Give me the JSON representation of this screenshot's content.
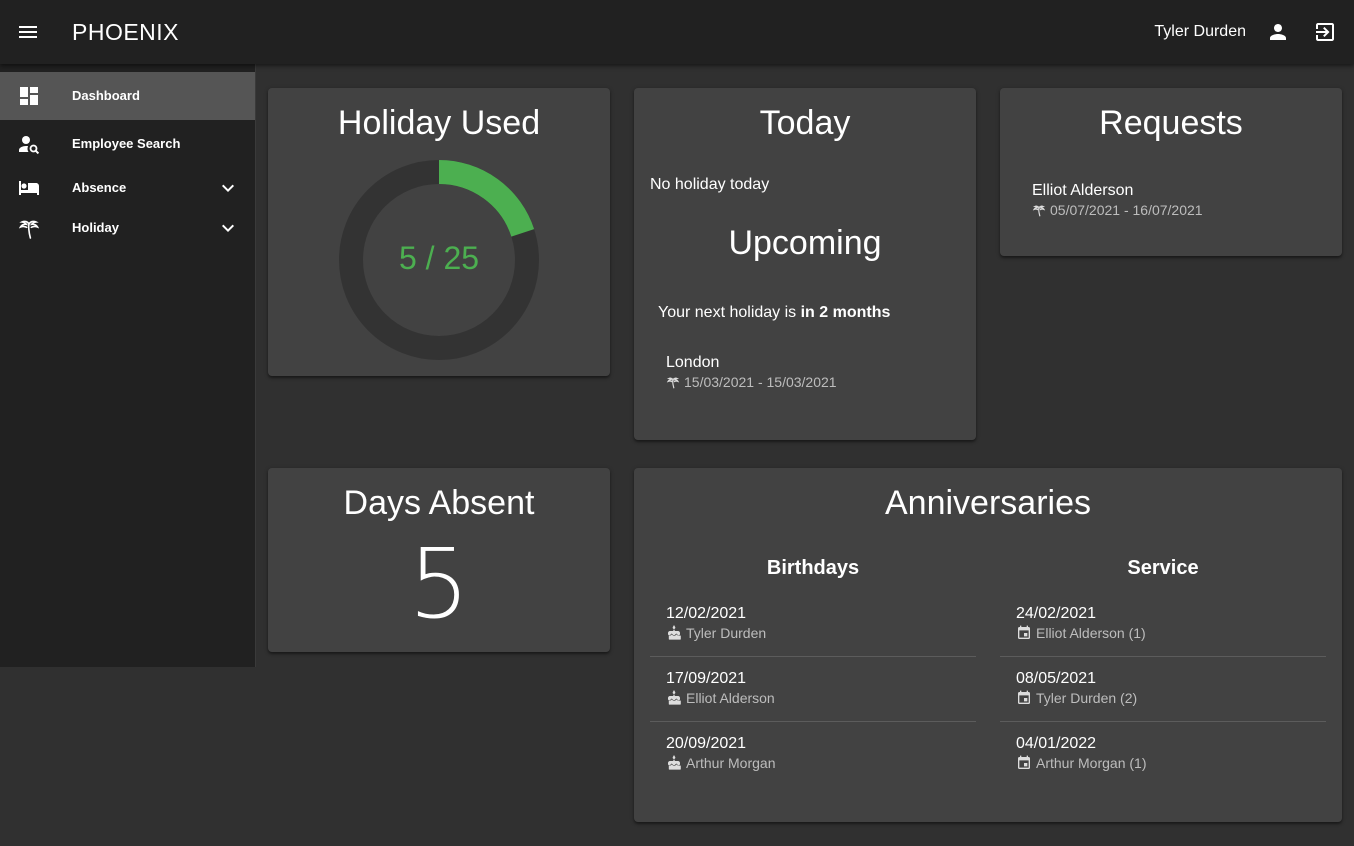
{
  "app": {
    "title": "PHOENIX"
  },
  "header": {
    "user_name": "Tyler Durden"
  },
  "nav": {
    "items": [
      {
        "label": "Dashboard",
        "icon": "dashboard-icon",
        "active": true
      },
      {
        "label": "Employee Search",
        "icon": "person-search-icon"
      },
      {
        "label": "Absence",
        "icon": "bed-icon",
        "expandable": true
      },
      {
        "label": "Holiday",
        "icon": "beach-icon",
        "expandable": true
      }
    ]
  },
  "holiday_used": {
    "title": "Holiday Used",
    "text": "5 / 25",
    "used": 5,
    "total": 25,
    "accent": "#4caf50"
  },
  "today": {
    "title": "Today",
    "status": "No holiday today",
    "upcoming_title": "Upcoming",
    "next_prefix": "Your next holiday is ",
    "next_bold": "in 2 months",
    "upcoming_item": {
      "name": "London",
      "dates": "15/03/2021 - 15/03/2021"
    }
  },
  "requests": {
    "title": "Requests",
    "items": [
      {
        "name": "Elliot Alderson",
        "dates": "05/07/2021 - 16/07/2021"
      }
    ]
  },
  "days_absent": {
    "title": "Days Absent",
    "value": "5"
  },
  "anniversaries": {
    "title": "Anniversaries",
    "birthdays": {
      "title": "Birthdays",
      "items": [
        {
          "date": "12/02/2021",
          "name": "Tyler Durden"
        },
        {
          "date": "17/09/2021",
          "name": "Elliot Alderson"
        },
        {
          "date": "20/09/2021",
          "name": "Arthur Morgan"
        }
      ]
    },
    "service": {
      "title": "Service",
      "items": [
        {
          "date": "24/02/2021",
          "name": "Elliot Alderson (1)"
        },
        {
          "date": "08/05/2021",
          "name": "Tyler Durden (2)"
        },
        {
          "date": "04/01/2022",
          "name": "Arthur Morgan (1)"
        }
      ]
    }
  }
}
